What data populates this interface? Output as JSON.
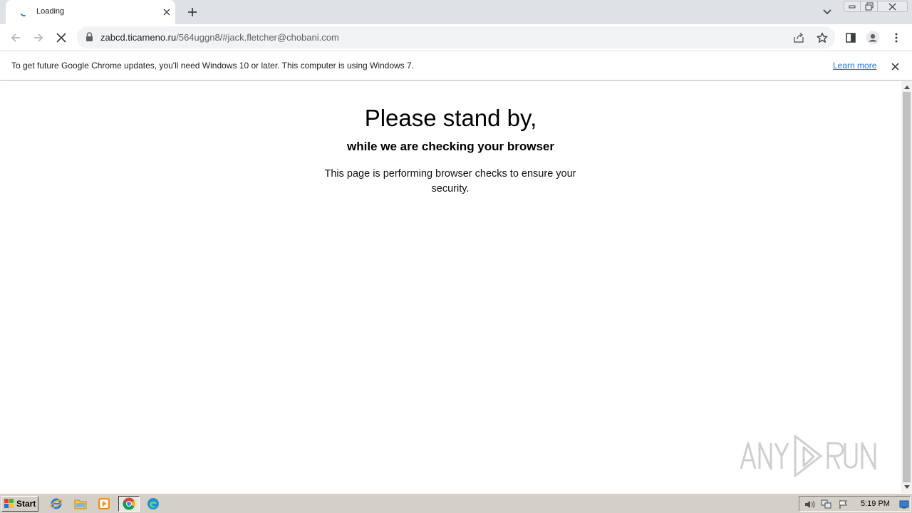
{
  "tab": {
    "title": "Loading"
  },
  "toolbar": {
    "url_host": "zabcd.ticameno.ru",
    "url_path": "/564uggn8/#jack.fletcher@chobani.com"
  },
  "infobar": {
    "message": "To get future Google Chrome updates, you'll need Windows 10 or later. This computer is using Windows 7.",
    "link": "Learn more"
  },
  "page": {
    "heading": "Please stand by,",
    "subheading": "while we are checking your browser",
    "description": "This page is performing browser checks to ensure your security."
  },
  "watermark": {
    "text": "ANY RUN"
  },
  "taskbar": {
    "start_label": "Start",
    "clock": "5:19 PM"
  },
  "colors": {
    "tabstrip": "#dee1e6",
    "omnibox": "#f1f3f4",
    "link": "#1a73e8",
    "taskbar": "#d4d0c8"
  }
}
